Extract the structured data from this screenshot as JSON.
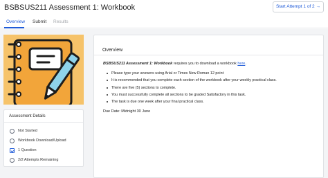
{
  "header": {
    "title": "BSBSUS211 Assessment 1: Workbook",
    "start_button": "Start Attempt 1 of 2 →"
  },
  "tabs": [
    {
      "label": "Overview",
      "state": "active"
    },
    {
      "label": "Submit",
      "state": "normal"
    },
    {
      "label": "Results",
      "state": "disabled"
    }
  ],
  "hero": {
    "icon": "notebook-pen-illustration",
    "colors": {
      "background": "#f6c36a",
      "notebook": "#f2a53a",
      "cover": "#ffffff",
      "ink": "#1d1d1d",
      "pen": "#8fd3ea"
    }
  },
  "details": {
    "title": "Assessment Details",
    "items": [
      {
        "label": "Not Started",
        "icon": "circle-icon"
      },
      {
        "label": "Workbook Download/Upload",
        "icon": "circle-icon"
      },
      {
        "label": "1 Question",
        "icon": "checkbox-icon"
      },
      {
        "label": "2/2 Attempts Remaining",
        "icon": "circle-icon"
      }
    ]
  },
  "overview": {
    "title": "Overview",
    "intro_bold": "BSBSUS211 Assessment 1: Workbook",
    "intro_text": " requires you to download a workbook ",
    "intro_link": "here",
    "intro_end": ".",
    "bullets": [
      "Please type your answers using Arial or Times New Roman 12 point",
      "It is recommended that you complete each section of the workbook after your weekly practical class.",
      "There are five (5) sections to complete.",
      "You must successfully complete all sections to be graded Satisfactory in this task.",
      "The task is due one week after your final practical class."
    ],
    "due": "Due Date: Midnight 30 June"
  },
  "colors": {
    "accent": "#1f5bd8",
    "page_bg": "#f3f4f6"
  }
}
